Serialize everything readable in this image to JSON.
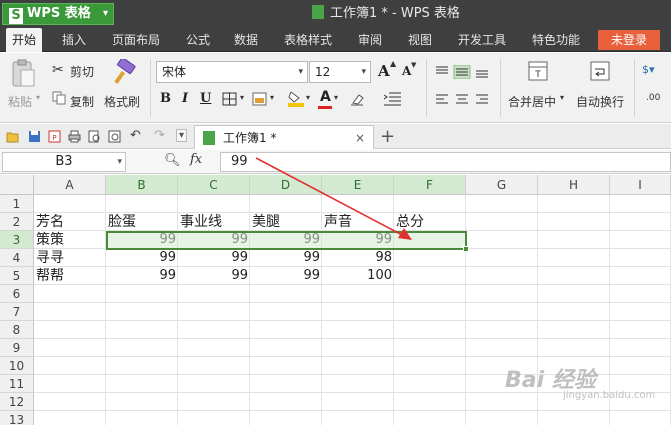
{
  "app": {
    "name": "WPS 表格",
    "logo_letter": "S",
    "window_title": "工作簿1 * - WPS 表格",
    "login_label": "未登录"
  },
  "menu": {
    "tabs": [
      "开始",
      "插入",
      "页面布局",
      "公式",
      "数据",
      "表格样式",
      "审阅",
      "视图",
      "开发工具",
      "特色功能"
    ],
    "active": "开始"
  },
  "ribbon": {
    "paste": "粘贴",
    "cut": "剪切",
    "copy": "复制",
    "format_painter": "格式刷",
    "font_name": "宋体",
    "font_size": "12",
    "merge_center": "合并居中",
    "wrap_text": "自动换行",
    "bold": "B",
    "italic": "I",
    "underline": "U",
    "grow_font": "A",
    "shrink_font": "A"
  },
  "document_tab": {
    "label": "工作簿1 *",
    "close": "×",
    "new_tab": "+"
  },
  "formula_bar": {
    "name_box": "B3",
    "fx": "fx",
    "value": "99"
  },
  "sheet": {
    "columns": [
      "A",
      "B",
      "C",
      "D",
      "E",
      "F",
      "G",
      "H",
      "I"
    ],
    "rows": [
      "1",
      "2",
      "3",
      "4",
      "5",
      "6",
      "7",
      "8",
      "9",
      "10",
      "11",
      "12",
      "13"
    ],
    "selected_row": "3",
    "selected_columns": [
      "B",
      "C",
      "D",
      "E",
      "F"
    ],
    "header_row": {
      "A": "芳名",
      "B": "脸蛋",
      "C": "事业线",
      "D": "美腿",
      "E": "声音",
      "F": "总分"
    },
    "data": [
      {
        "name": "策策",
        "values": [
          "99",
          "99",
          "99",
          "99"
        ]
      },
      {
        "name": "寻寻",
        "values": [
          "99",
          "99",
          "99",
          "98"
        ]
      },
      {
        "name": "帮帮",
        "values": [
          "99",
          "99",
          "99",
          "100"
        ]
      }
    ]
  },
  "watermark": {
    "text": "Bai 经验",
    "sub": "jingyan.baidu.com"
  },
  "colors": {
    "accent_green": "#3a9a3a",
    "login_orange": "#e8603c",
    "arrow_red": "#e03030"
  }
}
